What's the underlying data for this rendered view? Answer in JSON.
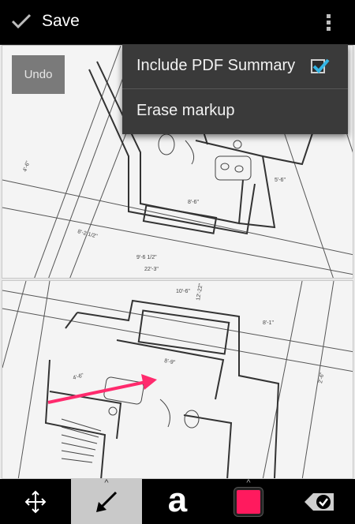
{
  "actionbar": {
    "save_label": "Save"
  },
  "overflow_menu": {
    "items": [
      {
        "label": "Include PDF Summary",
        "checked": true
      },
      {
        "label": "Erase markup"
      }
    ]
  },
  "document": {
    "undo_label": "Undo",
    "arrow_markup_color": "#ff2a6d",
    "page1_dimensions": [
      "8'-6\"",
      "8'-2 1/2\"",
      "9'-6 1/2\"",
      "22'-3\"",
      "5'-6\"",
      "4'-6\""
    ],
    "page2_dimensions": [
      "8'-9\"",
      "10'-6\"",
      "12'-22\"",
      "8'-1\"",
      "4'-6\"",
      "2'-6\""
    ]
  },
  "toolbar": {
    "tools": [
      {
        "icon": "move-icon"
      },
      {
        "icon": "arrow-markup-icon",
        "selected": true
      },
      {
        "icon": "text-tool-icon",
        "glyph": "a"
      },
      {
        "icon": "color-swatch-icon",
        "color": "#ff1a5e"
      },
      {
        "icon": "erase-confirm-icon"
      }
    ]
  }
}
